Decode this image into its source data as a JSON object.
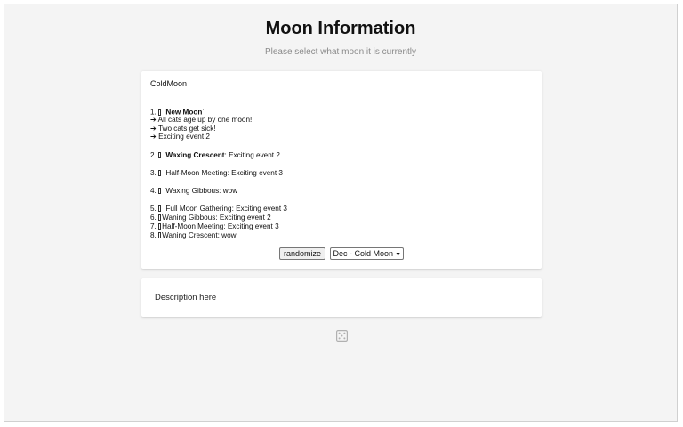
{
  "page": {
    "title": "Moon Information",
    "subtitle": "Please select what moon it is currently"
  },
  "moon_card": {
    "moon_name": "ColdMoon",
    "events": [
      {
        "number": "1.",
        "name": "New Moon",
        "suffix": "·",
        "sub_events": [
          "➔ All cats age up by one moon!",
          "➔ Two cats get sick!",
          "➔ Exciting event 2"
        ]
      },
      {
        "number": "2.",
        "name": "Waxing Crescent",
        "text": ": Exciting event 2"
      },
      {
        "number": "3.",
        "text": "Half-Moon Meeting: Exciting event 3"
      },
      {
        "number": "4.",
        "text": "Waxing Gibbous: wow"
      },
      {
        "number": "5.",
        "text": "Full Moon Gathering: Exciting event 3"
      },
      {
        "number": "6.",
        "text": "Waning Gibbous: Exciting event 2"
      },
      {
        "number": "7.",
        "text": "Half-Moon Meeting: Exciting event 3"
      },
      {
        "number": "8.",
        "text": "Waning Crescent: wow"
      }
    ],
    "randomize_label": "randomize",
    "moon_select": {
      "selected": "Dec - Cold Moon"
    }
  },
  "description_card": {
    "text": "Description here"
  },
  "icons": {
    "event_glyph": "missing-glyph-box-icon",
    "dice": "dice-icon",
    "dice_color": "#b0b0b0"
  }
}
